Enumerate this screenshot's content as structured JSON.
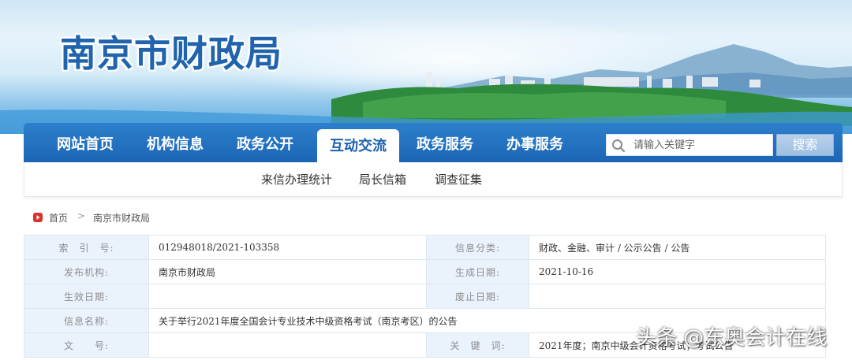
{
  "header": {
    "site_title": "南京市财政局"
  },
  "nav": {
    "items": [
      {
        "label": "网站首页"
      },
      {
        "label": "机构信息"
      },
      {
        "label": "政务公开"
      },
      {
        "label": "互动交流",
        "active": true
      },
      {
        "label": "政务服务"
      },
      {
        "label": "办事服务"
      }
    ],
    "search_placeholder": "请输入关键字",
    "search_button": "搜索"
  },
  "subnav": {
    "items": [
      {
        "label": "来信办理统计"
      },
      {
        "label": "局长信箱"
      },
      {
        "label": "调查征集"
      }
    ]
  },
  "breadcrumb": {
    "home": "首页",
    "separator": ">",
    "current": "南京市财政局"
  },
  "info": {
    "rows": [
      {
        "label": "索　引　号:",
        "value": "012948018/2021-103358",
        "label2": "信息分类:",
        "value2": "财政、金融、审计 / 公示公告 / 公告"
      },
      {
        "label": "发布机构:",
        "value": "南京市财政局",
        "label2": "生成日期:",
        "value2": "2021-10-16"
      },
      {
        "label": "生效日期:",
        "value": "",
        "label2": "废止日期:",
        "value2": ""
      },
      {
        "label": "信息名称:",
        "value": "关于举行2021年度全国会计专业技术中级资格考试（南京考区）的公告"
      },
      {
        "label": "文　　号:",
        "value": "",
        "label2": "关　键　词:",
        "value2": "2021年度；南京中级会计资格考试；考试公告"
      }
    ]
  },
  "watermark": {
    "text": "头条 @东奥会计在线"
  },
  "colors": {
    "nav_blue": "#1b66b5",
    "title_blue": "#1f64ad",
    "label_bg": "#eaf2fb",
    "home_icon_red": "#d9322b"
  }
}
